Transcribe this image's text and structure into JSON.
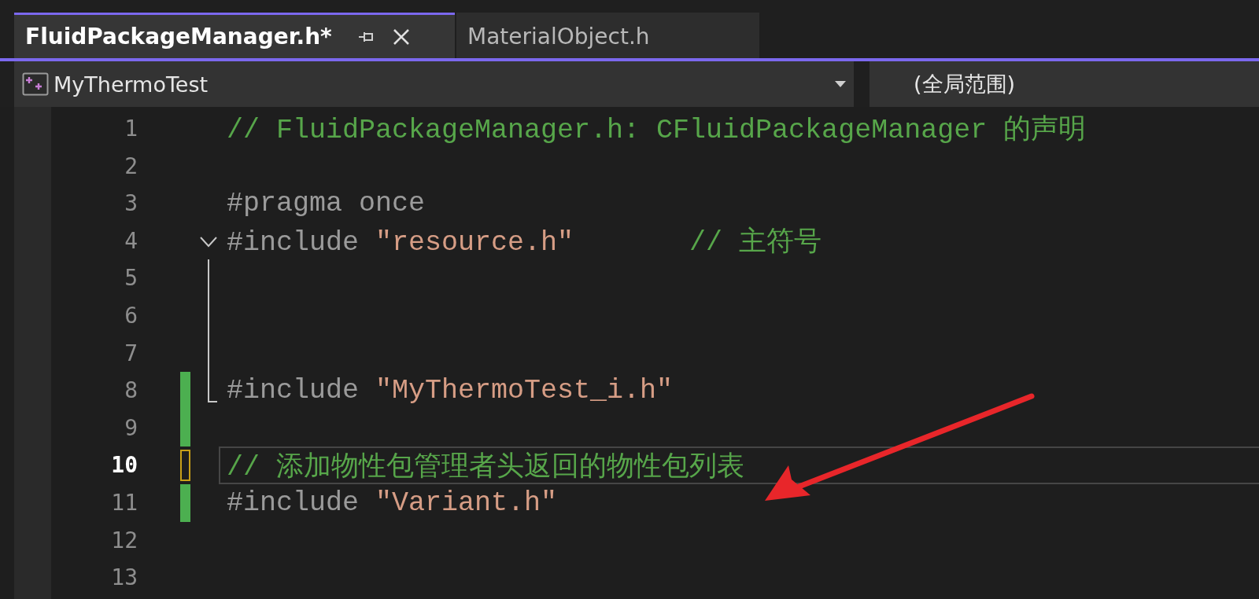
{
  "tabs": [
    {
      "title": "FluidPackageManager.h*",
      "selected": true
    },
    {
      "title": "MaterialObject.h",
      "selected": false
    }
  ],
  "navigation_bar": {
    "project": "MyThermoTest",
    "scope": "(全局范围)"
  },
  "editor": {
    "lines": [
      {
        "number": "1",
        "changed": false,
        "saved": false,
        "current": false,
        "expanded": false,
        "in_fold": false,
        "fold_end": false,
        "segments": [
          {
            "kind": "comment",
            "text": "// FluidPackageManager.h: CFluidPackageManager 的声明"
          }
        ]
      },
      {
        "number": "2",
        "changed": false,
        "saved": false,
        "current": false,
        "expanded": false,
        "in_fold": false,
        "fold_end": false
      },
      {
        "number": "3",
        "changed": false,
        "saved": false,
        "current": false,
        "expanded": false,
        "in_fold": false,
        "fold_end": false,
        "segments": [
          {
            "kind": "preprocessor",
            "text": "#pragma once"
          }
        ]
      },
      {
        "number": "4",
        "changed": false,
        "saved": false,
        "current": false,
        "expanded": true,
        "in_fold": false,
        "fold_end": false,
        "segments": [
          {
            "kind": "preprocessor",
            "text": "#include "
          },
          {
            "kind": "string",
            "text": "\"resource.h\""
          },
          {
            "kind": "comment",
            "text": "       // 主符号"
          }
        ]
      },
      {
        "number": "5",
        "changed": false,
        "saved": false,
        "current": false,
        "expanded": false,
        "in_fold": true,
        "fold_end": false
      },
      {
        "number": "6",
        "changed": false,
        "saved": false,
        "current": false,
        "expanded": false,
        "in_fold": true,
        "fold_end": false
      },
      {
        "number": "7",
        "changed": false,
        "saved": false,
        "current": false,
        "expanded": false,
        "in_fold": true,
        "fold_end": false
      },
      {
        "number": "8",
        "changed": true,
        "saved": true,
        "current": false,
        "expanded": false,
        "in_fold": true,
        "fold_end": true,
        "segments": [
          {
            "kind": "preprocessor",
            "text": "#include "
          },
          {
            "kind": "string",
            "text": "\"MyThermoTest_i.h\""
          }
        ]
      },
      {
        "number": "9",
        "changed": true,
        "saved": true,
        "current": false,
        "expanded": false,
        "in_fold": false,
        "fold_end": false
      },
      {
        "number": "10",
        "changed": true,
        "saved": false,
        "current": true,
        "expanded": false,
        "in_fold": false,
        "fold_end": false,
        "segments": [
          {
            "kind": "comment",
            "text": "// 添加物性包管理者头返回的物性包列表"
          }
        ]
      },
      {
        "number": "11",
        "changed": true,
        "saved": true,
        "current": false,
        "expanded": false,
        "in_fold": false,
        "fold_end": false,
        "segments": [
          {
            "kind": "preprocessor",
            "text": "#include "
          },
          {
            "kind": "string",
            "text": "\"Variant.h\""
          }
        ]
      },
      {
        "number": "12",
        "changed": false,
        "saved": false,
        "current": false,
        "expanded": false,
        "in_fold": false,
        "fold_end": false
      },
      {
        "number": "13",
        "changed": false,
        "saved": false,
        "current": false,
        "expanded": false,
        "in_fold": false,
        "fold_end": false
      }
    ]
  }
}
